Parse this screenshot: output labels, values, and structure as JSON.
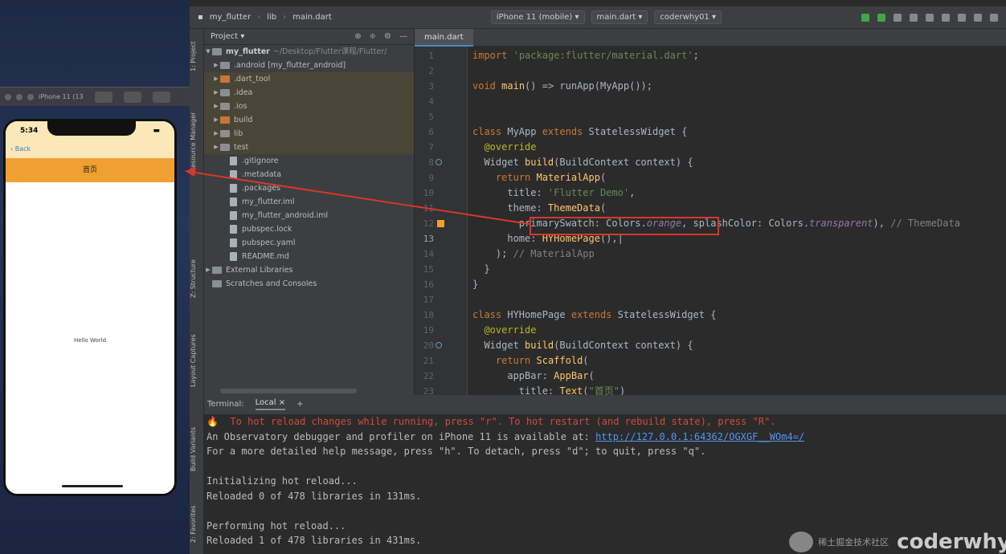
{
  "simulator": {
    "device_label": "iPhone 11 (13",
    "time": "5:34",
    "back_label": "Back",
    "appbar_title": "首页",
    "body_text": "Hello World"
  },
  "toolbar": {
    "project": "my_flutter",
    "folder": "lib",
    "file": "main.dart",
    "device": "iPhone 11 (mobile)",
    "run_config": "main.dart",
    "vcs": "coderwhy01"
  },
  "side_tabs": {
    "project": "1: Project",
    "resource_manager": "Resource Manager",
    "structure": "Z: Structure",
    "layout_captures": "Layout Captures",
    "build_variants": "Build Variants",
    "favorites": "2: Favorites"
  },
  "project_panel": {
    "title": "Project",
    "root": "my_flutter",
    "root_path": "~/Desktop/Flutter课程/Flutter/",
    "items": [
      {
        "label": ".android [my_flutter_android]",
        "type": "folder",
        "arrow": "▶"
      },
      {
        "label": ".dart_tool",
        "type": "folder-orange",
        "arrow": "▶"
      },
      {
        "label": ".idea",
        "type": "folder",
        "arrow": "▶"
      },
      {
        "label": ".ios",
        "type": "folder",
        "arrow": "▶"
      },
      {
        "label": "build",
        "type": "folder-orange",
        "arrow": "▶"
      },
      {
        "label": "lib",
        "type": "folder",
        "arrow": "▶"
      },
      {
        "label": "test",
        "type": "folder",
        "arrow": "▶"
      },
      {
        "label": ".gitignore",
        "type": "file",
        "arrow": ""
      },
      {
        "label": ".metadata",
        "type": "file",
        "arrow": ""
      },
      {
        "label": ".packages",
        "type": "file",
        "arrow": ""
      },
      {
        "label": "my_flutter.iml",
        "type": "file",
        "arrow": ""
      },
      {
        "label": "my_flutter_android.iml",
        "type": "file",
        "arrow": ""
      },
      {
        "label": "pubspec.lock",
        "type": "file",
        "arrow": ""
      },
      {
        "label": "pubspec.yaml",
        "type": "file",
        "arrow": ""
      },
      {
        "label": "README.md",
        "type": "file",
        "arrow": ""
      }
    ],
    "external": "External Libraries",
    "scratches": "Scratches and Consoles"
  },
  "editor": {
    "tab": "main.dart"
  },
  "terminal": {
    "title": "Terminal:",
    "tab": "Local",
    "line1": "🔥  To hot reload changes while running, press \"r\". To hot restart (and rebuild state), press \"R\".",
    "line2_pre": "An Observatory debugger and profiler on iPhone 11 is available at: ",
    "line2_link": "http://127.0.0.1:64362/OGXGF__WOm4=/",
    "line3": "For a more detailed help message, press \"h\". To detach, press \"d\"; to quit, press \"q\".",
    "line4": "",
    "line5": "Initializing hot reload...",
    "line6": "Reloaded 0 of 478 libraries in 131ms.",
    "line7": "",
    "line8": "Performing hot reload...",
    "line9": "Reloaded 1 of 478 libraries in 431ms."
  },
  "watermark": {
    "small": "稀土掘金技术社区",
    "big": "coderwhy"
  }
}
